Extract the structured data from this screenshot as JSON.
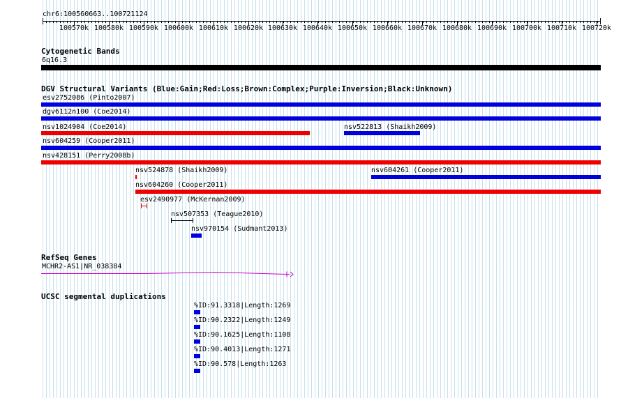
{
  "ruler": {
    "location": "chr6:100560663..100721124",
    "tick_labels": [
      "100570k",
      "100580k",
      "100590k",
      "100600k",
      "100610k",
      "100620k",
      "100630k",
      "100640k",
      "100650k",
      "100660k",
      "100670k",
      "100680k",
      "100690k",
      "100700k",
      "100710k",
      "100720k"
    ]
  },
  "cytoband": {
    "title": "Cytogenetic Bands",
    "band": "6q16.3"
  },
  "dgv": {
    "title": "DGV Structural Variants (Blue:Gain;Red:Loss;Brown:Complex;Purple:Inversion;Black:Unknown)",
    "colors": {
      "gain": "#0000dd",
      "loss": "#ee0000",
      "unknown": "#000000"
    },
    "variants": [
      {
        "id": "esv2752086 (Pinto2007)",
        "type": "gain"
      },
      {
        "id": "dgv6112n100 (Coe2014)",
        "type": "gain"
      },
      {
        "id": "nsv1024904 (Coe2014)",
        "type": "loss"
      },
      {
        "id": "nsv522813 (Shaikh2009)",
        "type": "gain"
      },
      {
        "id": "nsv604259 (Cooper2011)",
        "type": "gain"
      },
      {
        "id": "nsv428151 (Perry2008b)",
        "type": "loss"
      },
      {
        "id": "nsv524878 (Shaikh2009)",
        "type": "loss"
      },
      {
        "id": "nsv604261 (Cooper2011)",
        "type": "gain"
      },
      {
        "id": "nsv604260 (Cooper2011)",
        "type": "loss"
      },
      {
        "id": "esv2490977 (McKernan2009)",
        "type": "loss"
      },
      {
        "id": "nsv507353 (Teague2010)",
        "type": "unknown"
      },
      {
        "id": "nsv970154 (Sudmant2013)",
        "type": "gain"
      }
    ]
  },
  "refseq": {
    "title": "RefSeq Genes",
    "gene": "MCHR2-AS1|NR_038384",
    "color": "#cc00cc"
  },
  "segdup": {
    "title": "UCSC segmental duplications",
    "color": "#0000dd",
    "items": [
      "%ID:91.3318|Length:1269",
      "%ID:90.2322|Length:1249",
      "%ID:90.1625|Length:1108",
      "%ID:90.4013|Length:1271",
      "%ID:90.578|Length:1263"
    ]
  }
}
